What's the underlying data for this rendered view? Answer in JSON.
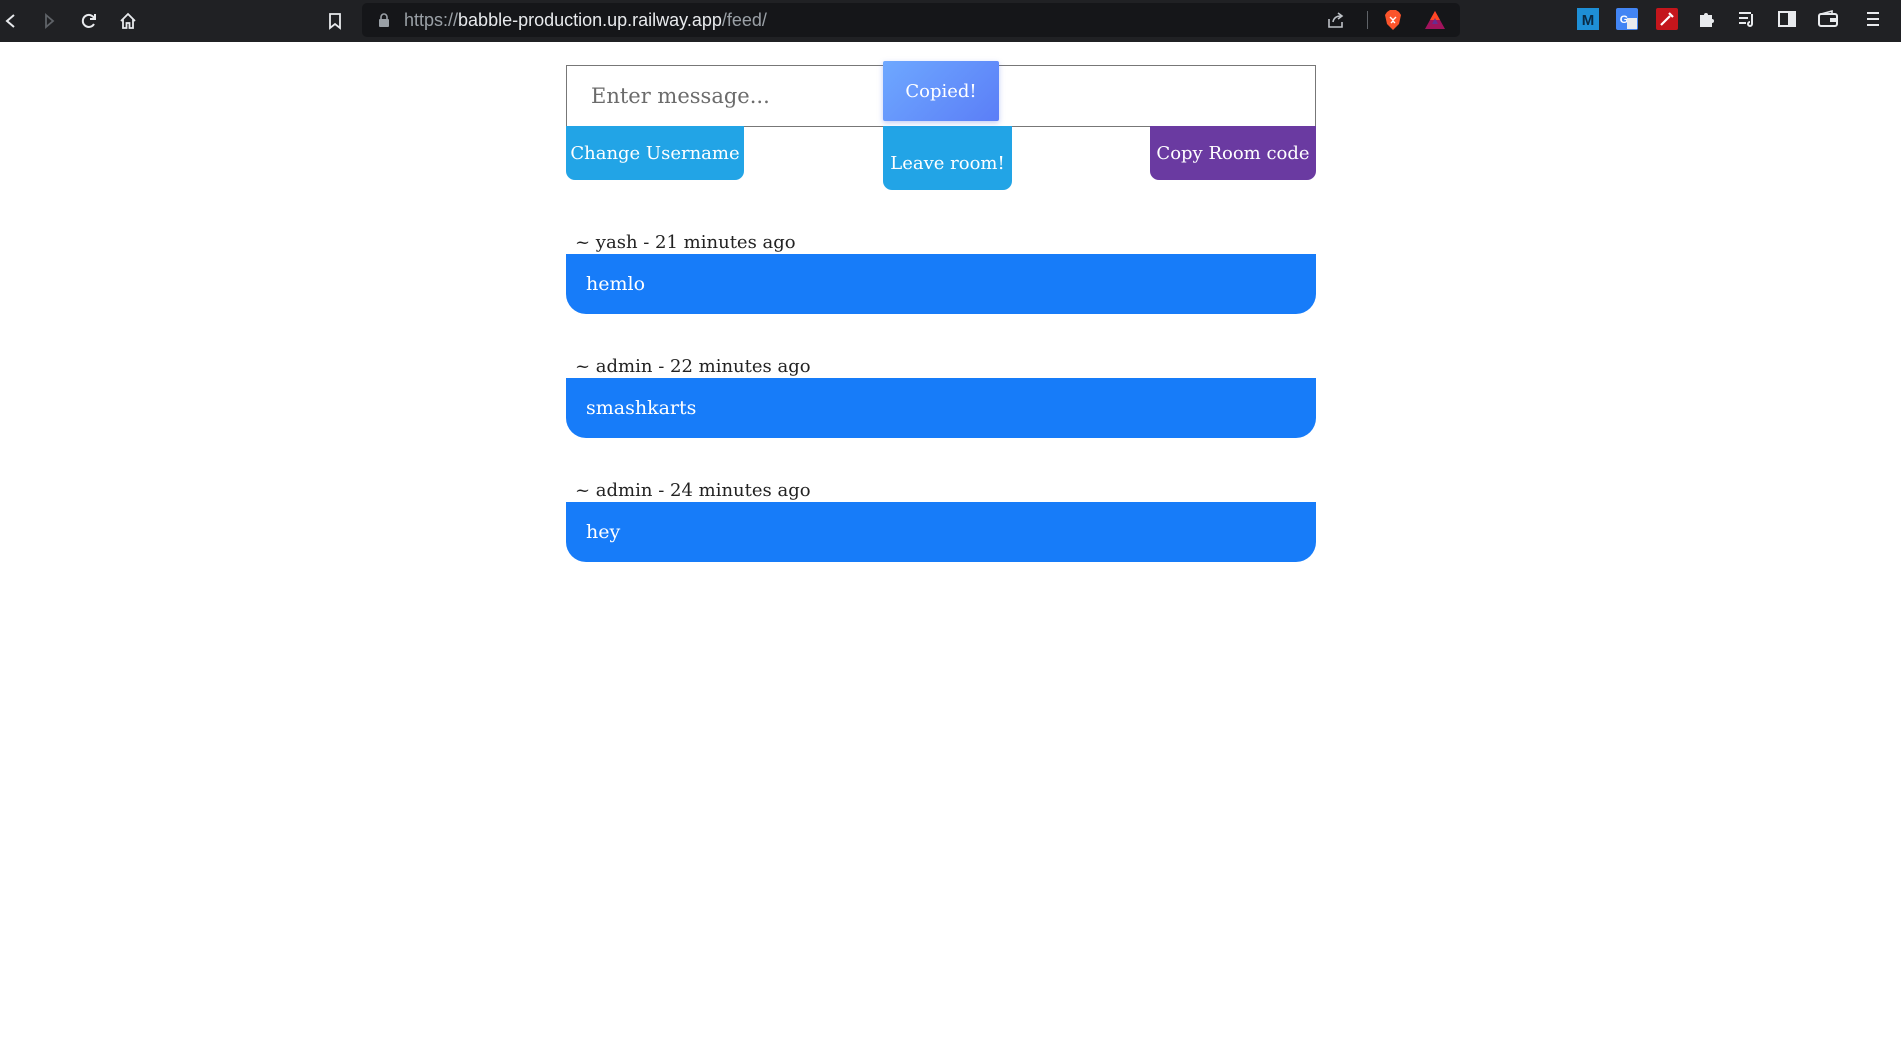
{
  "browser": {
    "url_scheme": "https://",
    "url_host": "babble-production.up.railway.app",
    "url_path": "/feed/",
    "icons": [
      "back-icon",
      "forward-icon",
      "reload-icon",
      "home-icon",
      "bookmark-icon",
      "lock-icon",
      "share-icon",
      "brave-shields-icon",
      "brave-rewards-icon",
      "m-extension-icon",
      "translate-extension-icon",
      "colorpick-extension-icon",
      "extensions-puzzle-icon",
      "reading-list-icon",
      "sidebar-icon",
      "wallet-icon",
      "menu-icon"
    ]
  },
  "composer": {
    "placeholder": "Enter message...",
    "toast": "Copied!",
    "change_username": "Change Username",
    "leave_room": "Leave room!",
    "copy_room_code": "Copy Room code"
  },
  "feed": [
    {
      "meta": "~ yash - 21 minutes ago",
      "text": "hemlo"
    },
    {
      "meta": "~ admin - 22 minutes ago",
      "text": "smashkarts"
    },
    {
      "meta": "~ admin - 24 minutes ago",
      "text": "hey"
    }
  ],
  "colors": {
    "chrome_bg": "#202124",
    "button_blue": "#22a4e6",
    "button_purple": "#6a3aa1",
    "bubble_blue": "#177cf9",
    "toast_gradient": "#6ea8ff"
  }
}
